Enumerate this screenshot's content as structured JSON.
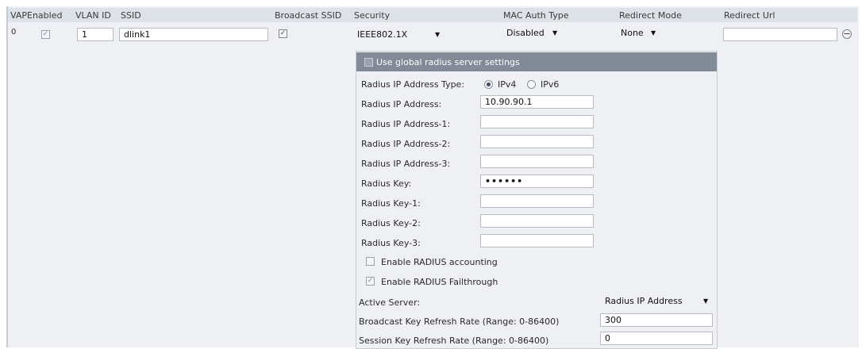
{
  "table": {
    "headers": [
      "VAP",
      "Enabled",
      "VLAN ID",
      "SSID",
      "Broadcast SSID",
      "Security",
      "MAC Auth Type",
      "Redirect Mode",
      "Redirect Url"
    ],
    "row": {
      "vap": "0",
      "enabled": true,
      "vlan_id": "1",
      "ssid": "dlink1",
      "broadcast_ssid": true,
      "security": "IEEE802.1X",
      "mac_auth_type": "Disabled",
      "redirect_mode": "None",
      "redirect_url": ""
    }
  },
  "radius": {
    "use_global_label": "Use global radius server settings",
    "use_global": false,
    "ip_type_label": "Radius IP Address Type:",
    "ipv4_label": "IPv4",
    "ipv6_label": "IPv6",
    "ip_type_selected": "IPv4",
    "ip_address_label": "Radius IP Address:",
    "ip_address": "10.90.90.1",
    "ip_address_1_label": "Radius IP Address-1:",
    "ip_address_1": "",
    "ip_address_2_label": "Radius IP Address-2:",
    "ip_address_2": "",
    "ip_address_3_label": "Radius IP Address-3:",
    "ip_address_3": "",
    "key_label": "Radius Key:",
    "key": "••••••",
    "key_1_label": "Radius Key-1:",
    "key_1": "",
    "key_2_label": "Radius Key-2:",
    "key_2": "",
    "key_3_label": "Radius Key-3:",
    "key_3": "",
    "accounting_label": "Enable RADIUS accounting",
    "accounting": false,
    "failthrough_label": "Enable RADIUS Failthrough",
    "failthrough": true,
    "active_server_label": "Active Server:",
    "active_server": "Radius IP Address",
    "bcast_refresh_label": "Broadcast Key Refresh Rate (Range: 0-86400)",
    "bcast_refresh": "300",
    "session_refresh_label": "Session Key Refresh Rate (Range: 0-86400)",
    "session_refresh": "0"
  },
  "icons": {
    "check": "✓",
    "dropdown_arrow": "▼",
    "remove": "−"
  }
}
